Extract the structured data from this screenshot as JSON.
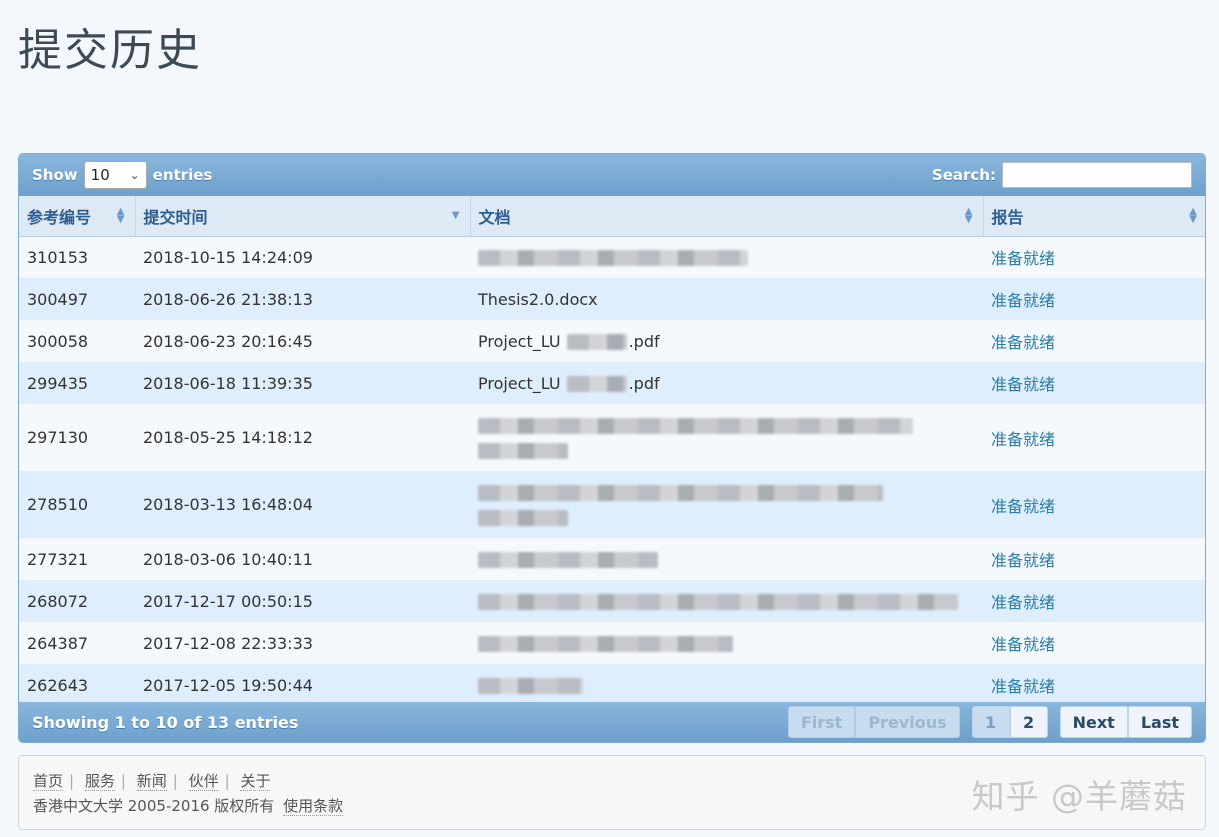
{
  "page": {
    "title": "提交历史"
  },
  "controls": {
    "show_label": "Show",
    "entries_label": "entries",
    "length_value": "10",
    "search_label": "Search:",
    "search_value": ""
  },
  "table": {
    "columns": [
      "参考编号",
      "提交时间",
      "文档",
      "报告"
    ],
    "rows": [
      {
        "id": "310153",
        "time": "2018-10-15 14:24:09",
        "doc": "",
        "doc_blurred": true,
        "report": "准备就绪"
      },
      {
        "id": "300497",
        "time": "2018-06-26 21:38:13",
        "doc": "Thesis2.0.docx",
        "doc_blurred": false,
        "report": "准备就绪"
      },
      {
        "id": "300058",
        "time": "2018-06-23 20:16:45",
        "doc": "Project_LU",
        "doc_suffix": ".pdf",
        "doc_partial": true,
        "report": "准备就绪"
      },
      {
        "id": "299435",
        "time": "2018-06-18 11:39:35",
        "doc": "Project_LU",
        "doc_suffix": ".pdf",
        "doc_partial": true,
        "report": "准备就绪"
      },
      {
        "id": "297130",
        "time": "2018-05-25 14:18:12",
        "doc": "",
        "doc_blurred": true,
        "tall": true,
        "report": "准备就绪"
      },
      {
        "id": "278510",
        "time": "2018-03-13 16:48:04",
        "doc": "",
        "doc_blurred": true,
        "tall": true,
        "report": "准备就绪"
      },
      {
        "id": "277321",
        "time": "2018-03-06 10:40:11",
        "doc": "",
        "doc_blurred": true,
        "report": "准备就绪"
      },
      {
        "id": "268072",
        "time": "2017-12-17 00:50:15",
        "doc": "",
        "doc_blurred": true,
        "report": "准备就绪"
      },
      {
        "id": "264387",
        "time": "2017-12-08 22:33:33",
        "doc": "",
        "doc_blurred": true,
        "report": "准备就绪"
      },
      {
        "id": "262643",
        "time": "2017-12-05 19:50:44",
        "doc": "",
        "doc_blurred": true,
        "report": "准备就绪"
      }
    ]
  },
  "info": "Showing 1 to 10 of 13 entries",
  "pagination": {
    "first": "First",
    "previous": "Previous",
    "pages": [
      "1",
      "2"
    ],
    "current_page": "1",
    "next": "Next",
    "last": "Last"
  },
  "footer": {
    "links": [
      "首页",
      "服务",
      "新闻",
      "伙伴",
      "关于"
    ],
    "copyright": "香港中文大学 2005-2016 版权所有",
    "terms": "使用条款"
  },
  "watermark": "知乎 @羊蘑菇",
  "colors": {
    "header_bar": "#7aaad5",
    "row_alt": "#dfeefc",
    "report_link": "#2a7da8",
    "title": "#3b4a55"
  }
}
